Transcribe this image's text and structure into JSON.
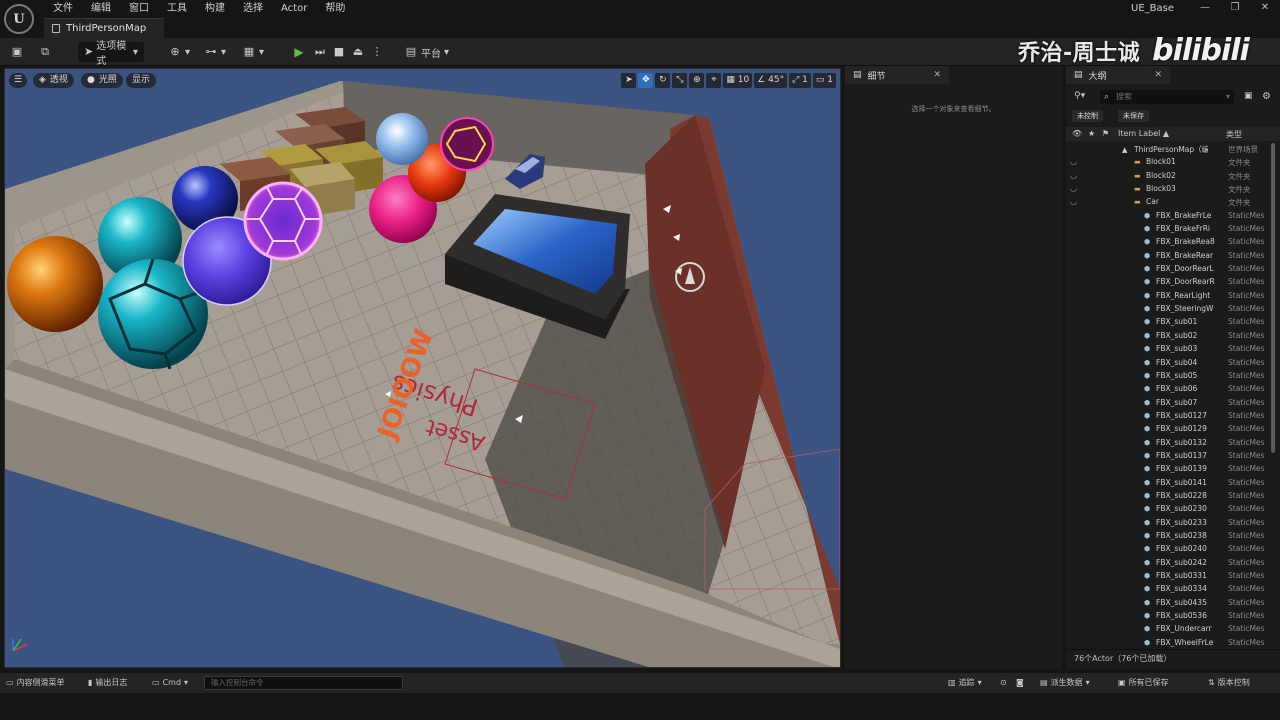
{
  "app": {
    "project": "UE_Base",
    "logo_letter": "U"
  },
  "menu": [
    "文件",
    "编辑",
    "窗口",
    "工具",
    "构建",
    "选择",
    "Actor",
    "帮助"
  ],
  "window_controls": [
    "—",
    "❐",
    "✕"
  ],
  "tab": {
    "label": "ThirdPersonMap"
  },
  "toolbar": {
    "mode_label": "选项模式",
    "platform_label": "平台"
  },
  "watermark": {
    "text": "乔治-周士诚",
    "logo": "bilibili"
  },
  "viewport": {
    "menu_icon": "☰",
    "perspective": "透视",
    "lighting": "光照",
    "show": "显示",
    "grid_size": "10",
    "angle": "45°",
    "scale": "1",
    "camera_speed": "1",
    "decal_text_1": "Physics",
    "decal_text_2": "Asset",
    "decal_text_3": "JOIOOW"
  },
  "details": {
    "tab_label": "细节",
    "empty_hint": "选择一个对象来查看细节。"
  },
  "outliner": {
    "tab_label": "大纲",
    "search_placeholder": "搜索",
    "filter_unsaved_control": "未控制",
    "filter_unsaved": "未保存",
    "header_label": "Item Label ▲",
    "header_type": "类型",
    "footer": "76个Actor（76个已加载）",
    "rows": [
      {
        "label": "ThirdPersonMap（编",
        "type": "世界场景",
        "kind": "world",
        "indent": 0
      },
      {
        "label": "Block01",
        "type": "文件夹",
        "kind": "folder",
        "indent": 1
      },
      {
        "label": "Block02",
        "type": "文件夹",
        "kind": "folder",
        "indent": 1
      },
      {
        "label": "Block03",
        "type": "文件夹",
        "kind": "folder",
        "indent": 1
      },
      {
        "label": "Car",
        "type": "文件夹",
        "kind": "folder-open",
        "indent": 1
      },
      {
        "label": "FBX_BrakeFrLe",
        "type": "StaticMes",
        "kind": "mesh",
        "indent": 2
      },
      {
        "label": "FBX_BrakeFrRi",
        "type": "StaticMes",
        "kind": "mesh",
        "indent": 2
      },
      {
        "label": "FBX_BrakeRea8",
        "type": "StaticMes",
        "kind": "mesh",
        "indent": 2
      },
      {
        "label": "FBX_BrakeRear",
        "type": "StaticMes",
        "kind": "mesh",
        "indent": 2
      },
      {
        "label": "FBX_DoorRearL",
        "type": "StaticMes",
        "kind": "mesh",
        "indent": 2
      },
      {
        "label": "FBX_DoorRearR",
        "type": "StaticMes",
        "kind": "mesh",
        "indent": 2
      },
      {
        "label": "FBX_RearLight",
        "type": "StaticMes",
        "kind": "mesh",
        "indent": 2
      },
      {
        "label": "FBX_SteeringW",
        "type": "StaticMes",
        "kind": "mesh",
        "indent": 2
      },
      {
        "label": "FBX_sub01",
        "type": "StaticMes",
        "kind": "mesh",
        "indent": 2
      },
      {
        "label": "FBX_sub02",
        "type": "StaticMes",
        "kind": "mesh",
        "indent": 2
      },
      {
        "label": "FBX_sub03",
        "type": "StaticMes",
        "kind": "mesh",
        "indent": 2
      },
      {
        "label": "FBX_sub04",
        "type": "StaticMes",
        "kind": "mesh",
        "indent": 2
      },
      {
        "label": "FBX_sub05",
        "type": "StaticMes",
        "kind": "mesh",
        "indent": 2
      },
      {
        "label": "FBX_sub06",
        "type": "StaticMes",
        "kind": "mesh",
        "indent": 2
      },
      {
        "label": "FBX_sub07",
        "type": "StaticMes",
        "kind": "mesh",
        "indent": 2
      },
      {
        "label": "FBX_sub0127",
        "type": "StaticMes",
        "kind": "mesh",
        "indent": 2
      },
      {
        "label": "FBX_sub0129",
        "type": "StaticMes",
        "kind": "mesh",
        "indent": 2
      },
      {
        "label": "FBX_sub0132",
        "type": "StaticMes",
        "kind": "mesh",
        "indent": 2
      },
      {
        "label": "FBX_sub0137",
        "type": "StaticMes",
        "kind": "mesh",
        "indent": 2
      },
      {
        "label": "FBX_sub0139",
        "type": "StaticMes",
        "kind": "mesh",
        "indent": 2
      },
      {
        "label": "FBX_sub0141",
        "type": "StaticMes",
        "kind": "mesh",
        "indent": 2
      },
      {
        "label": "FBX_sub0228",
        "type": "StaticMes",
        "kind": "mesh",
        "indent": 2
      },
      {
        "label": "FBX_sub0230",
        "type": "StaticMes",
        "kind": "mesh",
        "indent": 2
      },
      {
        "label": "FBX_sub0233",
        "type": "StaticMes",
        "kind": "mesh",
        "indent": 2
      },
      {
        "label": "FBX_sub0238",
        "type": "StaticMes",
        "kind": "mesh",
        "indent": 2
      },
      {
        "label": "FBX_sub0240",
        "type": "StaticMes",
        "kind": "mesh",
        "indent": 2
      },
      {
        "label": "FBX_sub0242",
        "type": "StaticMes",
        "kind": "mesh",
        "indent": 2
      },
      {
        "label": "FBX_sub0331",
        "type": "StaticMes",
        "kind": "mesh",
        "indent": 2
      },
      {
        "label": "FBX_sub0334",
        "type": "StaticMes",
        "kind": "mesh",
        "indent": 2
      },
      {
        "label": "FBX_sub0435",
        "type": "StaticMes",
        "kind": "mesh",
        "indent": 2
      },
      {
        "label": "FBX_sub0536",
        "type": "StaticMes",
        "kind": "mesh",
        "indent": 2
      },
      {
        "label": "FBX_Undercarr",
        "type": "StaticMes",
        "kind": "mesh",
        "indent": 2
      },
      {
        "label": "FBX_WheelFrLe",
        "type": "StaticMes",
        "kind": "mesh",
        "indent": 2
      }
    ]
  },
  "statusbar": {
    "content_drawer": "内容侧滑菜单",
    "output_log": "输出日志",
    "cmd": "Cmd",
    "cmd_placeholder": "输入控制台命令",
    "trace": "追踪",
    "derived_data": "派生数据",
    "all_saved": "所有已保存",
    "source_control": "版本控制"
  },
  "colors": {
    "accent_blue": "#2d6fbf",
    "play_green": "#5fbf3f",
    "panel_bg": "#1b1b1b",
    "toolbar_bg": "#242424"
  }
}
